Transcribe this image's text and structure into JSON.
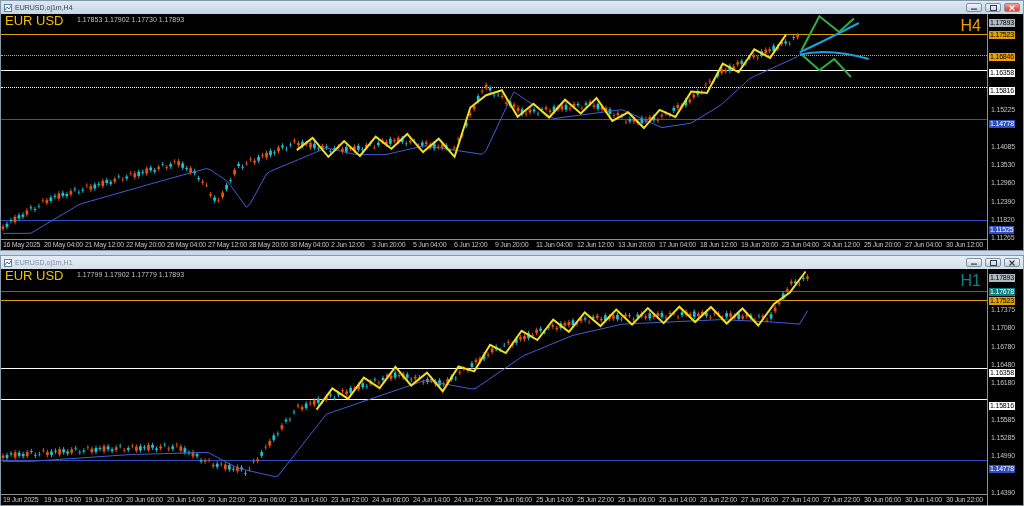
{
  "windows": [
    {
      "title": "EURUSD,oj1m,H4",
      "symbol": "EUR USD",
      "ohlc": "1.17853 1.17902 1.17730 1.17893",
      "timeframe": "H4",
      "color": "#f0a000",
      "active": true,
      "price_ticks": [
        "1.15225",
        "1.14085",
        "1.13530",
        "1.12960",
        "1.12390",
        "1.11820",
        "1.11265"
      ],
      "levels": [
        {
          "price": "1.17893",
          "color": "#b0b8c0",
          "kind": "none"
        },
        {
          "price": "1.17523",
          "color": "#e0a000",
          "kind": "solid"
        },
        {
          "price": "1.16846",
          "color": "#f0a000",
          "kind": "dotted"
        },
        {
          "price": "1.16358",
          "color": "#ffffff",
          "kind": "solid"
        },
        {
          "price": "1.15816",
          "color": "#ffffff",
          "kind": "dotted"
        },
        {
          "price": "1.14778",
          "color": "#3050c0",
          "kind": "solid"
        },
        {
          "price": "1.11525",
          "color": "#3050c0",
          "kind": "solid"
        }
      ],
      "time_labels": [
        "16 May 2025",
        "20 May 04:00",
        "21 May 12:00",
        "22 May 20:00",
        "26 May 04:00",
        "27 May 12:00",
        "28 May 20:00",
        "30 May 04:00",
        "2 Jun 12:00",
        "3 Jun 20:00",
        "5 Jun 04:00",
        "6 Jun 12:00",
        "9 Jun 20:00",
        "11 Jun 04:00",
        "12 Jun 12:00",
        "13 Jun 20:00",
        "17 Jun 04:00",
        "18 Jun 12:00",
        "19 Jun 20:00",
        "23 Jun 04:00",
        "24 Jun 12:00",
        "25 Jun 20:00",
        "27 Jun 04:00",
        "30 Jun 12:00"
      ]
    },
    {
      "title": "EURUSD,oj1m,H1",
      "symbol": "EUR USD",
      "ohlc": "1.17799 1.17902 1.17779 1.17893",
      "timeframe": "H1",
      "color": "#108080",
      "active": false,
      "price_ticks": [
        "1.17375",
        "1.17080",
        "1.16780",
        "1.16480",
        "1.16180",
        "1.15585",
        "1.15285",
        "1.14990",
        "1.14390"
      ],
      "levels": [
        {
          "price": "1.17893",
          "color": "#b0b8c0",
          "kind": "none"
        },
        {
          "price": "1.17678",
          "color": "#108080",
          "kind": "solid"
        },
        {
          "price": "1.17523",
          "color": "#e0a000",
          "kind": "solid"
        },
        {
          "price": "1.16358",
          "color": "#ffffff",
          "kind": "solid"
        },
        {
          "price": "1.15816",
          "color": "#ffffff",
          "kind": "solid"
        },
        {
          "price": "1.14778",
          "color": "#3050c0",
          "kind": "solid"
        }
      ],
      "time_labels": [
        "19 Jun 2025",
        "19 Jun 14:00",
        "19 Jun 22:00",
        "20 Jun 06:00",
        "20 Jun 14:00",
        "20 Jun 22:00",
        "23 Jun 06:00",
        "23 Jun 14:00",
        "23 Jun 22:00",
        "24 Jun 06:00",
        "24 Jun 14:00",
        "24 Jun 22:00",
        "25 Jun 06:00",
        "25 Jun 14:00",
        "25 Jun 22:00",
        "26 Jun 06:00",
        "26 Jun 14:00",
        "26 Jun 22:00",
        "27 Jun 06:00",
        "27 Jun 14:00",
        "27 Jun 22:00",
        "30 Jun 06:00",
        "30 Jun 14:00",
        "30 Jun 22:00"
      ]
    }
  ]
}
